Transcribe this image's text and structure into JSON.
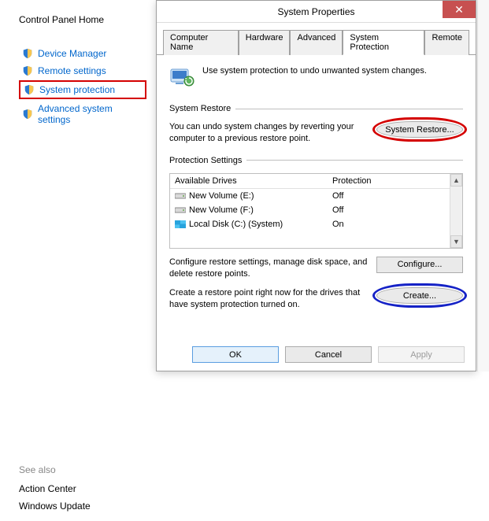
{
  "left": {
    "home": "Control Panel Home",
    "items": [
      {
        "label": "Device Manager"
      },
      {
        "label": "Remote settings"
      },
      {
        "label": "System protection",
        "highlighted": true
      },
      {
        "label": "Advanced system settings"
      }
    ],
    "see_also_title": "See also",
    "see_also": [
      {
        "label": "Action Center"
      },
      {
        "label": "Windows Update"
      }
    ]
  },
  "dialog": {
    "title": "System Properties",
    "close_glyph": "✕",
    "tabs": [
      {
        "label": "Computer Name"
      },
      {
        "label": "Hardware"
      },
      {
        "label": "Advanced"
      },
      {
        "label": "System Protection",
        "active": true
      },
      {
        "label": "Remote"
      }
    ],
    "intro": "Use system protection to undo unwanted system changes.",
    "restore": {
      "group_title": "System Restore",
      "text": "You can undo system changes by reverting your computer to a previous restore point.",
      "button": "System Restore..."
    },
    "protection": {
      "group_title": "Protection Settings",
      "col_drives": "Available Drives",
      "col_protection": "Protection",
      "rows": [
        {
          "name": "New Volume (E:)",
          "status": "Off",
          "icon": "hdd"
        },
        {
          "name": "New Volume (F:)",
          "status": "Off",
          "icon": "hdd"
        },
        {
          "name": "Local Disk (C:) (System)",
          "status": "On",
          "icon": "win"
        }
      ],
      "configure_text": "Configure restore settings, manage disk space, and delete restore points.",
      "configure_button": "Configure...",
      "create_text": "Create a restore point right now for the drives that have system protection turned on.",
      "create_button": "Create..."
    },
    "buttons": {
      "ok": "OK",
      "cancel": "Cancel",
      "apply": "Apply"
    }
  }
}
